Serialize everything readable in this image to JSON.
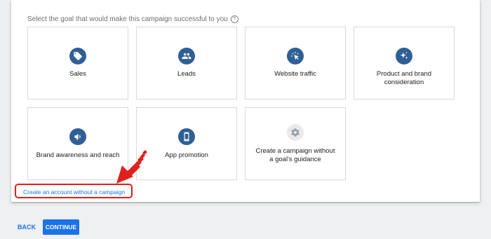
{
  "prompt": {
    "text": "Select the goal that would make this campaign successful to you",
    "help_glyph": "?"
  },
  "goals": [
    {
      "label": "Sales",
      "icon": "tag-icon"
    },
    {
      "label": "Leads",
      "icon": "people-icon"
    },
    {
      "label": "Website traffic",
      "icon": "cursor-click-icon"
    },
    {
      "label": "Product and brand consideration",
      "icon": "sparkle-icon"
    },
    {
      "label": "Brand awareness and reach",
      "icon": "megaphone-icon"
    },
    {
      "label": "App promotion",
      "icon": "phone-icon"
    },
    {
      "label": "Create a campaign without a goal's guidance",
      "icon": "gear-icon"
    }
  ],
  "link_text": "Create an account without a campaign",
  "buttons": {
    "back": "BACK",
    "continue": "CONTINUE"
  },
  "colors": {
    "accent": "#1a73e8",
    "icon_bg": "#2f5f96",
    "highlight": "#e0201c"
  }
}
